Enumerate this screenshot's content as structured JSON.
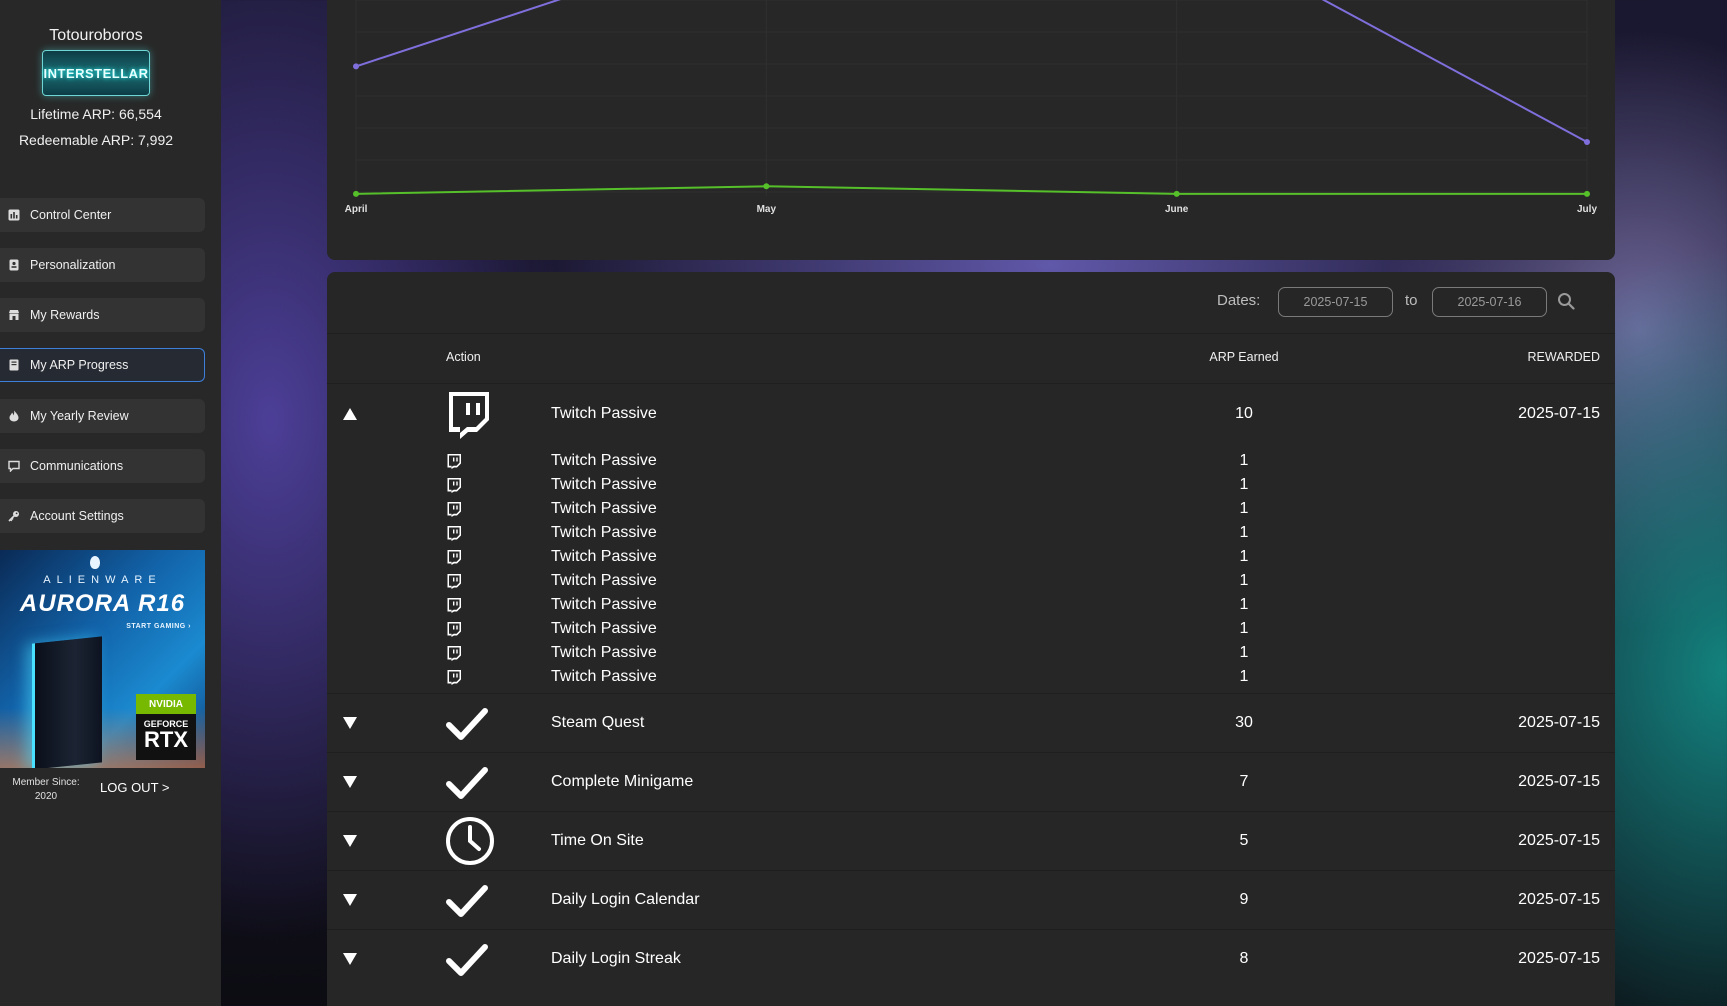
{
  "sidebar": {
    "user_name": "Totouroboros",
    "badge_text": "INTERSTELLAR",
    "lifetime_arp": "Lifetime ARP: 66,554",
    "redeemable_arp": "Redeemable ARP: 7,992",
    "nav": [
      {
        "label": "Control Center",
        "icon": "dashboard-icon"
      },
      {
        "label": "Personalization",
        "icon": "badge-icon"
      },
      {
        "label": "My Rewards",
        "icon": "store-icon"
      },
      {
        "label": "My ARP Progress",
        "icon": "book-icon",
        "active": true
      },
      {
        "label": "My Yearly Review",
        "icon": "fire-icon"
      },
      {
        "label": "Communications",
        "icon": "chat-icon"
      },
      {
        "label": "Account Settings",
        "icon": "key-icon"
      }
    ],
    "ad": {
      "brand": "ALIENWARE",
      "model": "AURORA R16",
      "tagline": "START GAMING ›",
      "nvidia": "NVIDIA",
      "geforce": "GEFORCE",
      "rtx": "RTX"
    },
    "member_since_label": "Member Since:",
    "member_since_year": "2020",
    "logout": "LOG OUT >"
  },
  "colors": {
    "series_purple": "#7f6fdc",
    "series_green": "#56c02a",
    "active_border": "#3d7fd9"
  },
  "chart_data": {
    "type": "line",
    "categories": [
      "April",
      "May",
      "June",
      "July"
    ],
    "series": [
      {
        "values": [
          12000,
          24500,
          25500,
          5000
        ]
      },
      {
        "values": [
          200,
          900,
          200,
          200
        ]
      }
    ],
    "ylim": [
      0,
      30000
    ]
  },
  "filters": {
    "dates_label": "Dates:",
    "from": "2025-07-15",
    "to_label": "to",
    "to": "2025-07-16"
  },
  "table": {
    "headers": {
      "action": "Action",
      "arp": "ARP Earned",
      "rewarded": "REWARDED"
    },
    "expanded_row": {
      "label": "Twitch Passive",
      "arp": "10",
      "date": "2025-07-15",
      "icon": "twitch-icon"
    },
    "sub_rows": [
      {
        "label": "Twitch Passive",
        "arp": "1"
      },
      {
        "label": "Twitch Passive",
        "arp": "1"
      },
      {
        "label": "Twitch Passive",
        "arp": "1"
      },
      {
        "label": "Twitch Passive",
        "arp": "1"
      },
      {
        "label": "Twitch Passive",
        "arp": "1"
      },
      {
        "label": "Twitch Passive",
        "arp": "1"
      },
      {
        "label": "Twitch Passive",
        "arp": "1"
      },
      {
        "label": "Twitch Passive",
        "arp": "1"
      },
      {
        "label": "Twitch Passive",
        "arp": "1"
      },
      {
        "label": "Twitch Passive",
        "arp": "1"
      }
    ],
    "rows": [
      {
        "label": "Steam Quest",
        "arp": "30",
        "date": "2025-07-15",
        "icon": "checkmark-icon"
      },
      {
        "label": "Complete Minigame",
        "arp": "7",
        "date": "2025-07-15",
        "icon": "checkmark-icon"
      },
      {
        "label": "Time On Site",
        "arp": "5",
        "date": "2025-07-15",
        "icon": "clock-icon"
      },
      {
        "label": "Daily Login Calendar",
        "arp": "9",
        "date": "2025-07-15",
        "icon": "checkmark-icon"
      },
      {
        "label": "Daily Login Streak",
        "arp": "8",
        "date": "2025-07-15",
        "icon": "checkmark-icon"
      }
    ]
  }
}
